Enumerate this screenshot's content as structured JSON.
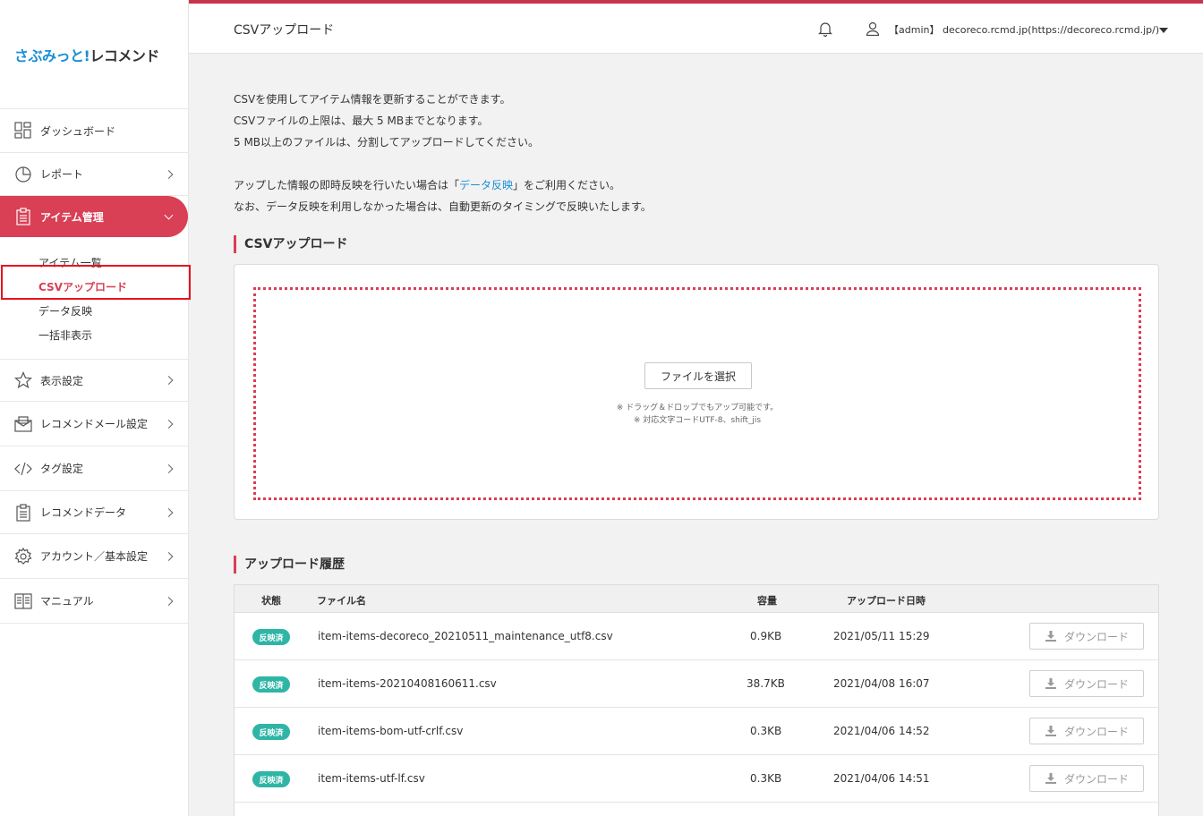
{
  "logo": {
    "part_a": "さぶみっと!",
    "part_b": "レコメンド"
  },
  "sidebar": {
    "items": [
      {
        "label": "ダッシュボード",
        "icon": "dashboard-icon"
      },
      {
        "label": "レポート",
        "icon": "pie-chart-icon"
      },
      {
        "label": "アイテム管理",
        "icon": "clipboard-icon"
      },
      {
        "label": "表示設定",
        "icon": "star-icon"
      },
      {
        "label": "レコメンドメール設定",
        "icon": "mail-icon"
      },
      {
        "label": "タグ設定",
        "icon": "code-icon"
      },
      {
        "label": "レコメンドデータ",
        "icon": "clipboard-icon"
      },
      {
        "label": "アカウント／基本設定",
        "icon": "gear-icon"
      },
      {
        "label": "マニュアル",
        "icon": "book-icon"
      }
    ],
    "sub_items": [
      "アイテム一覧",
      "CSVアップロード",
      "データ反映",
      "一括非表示"
    ]
  },
  "header": {
    "title": "CSVアップロード",
    "user": "【admin】 decoreco.rcmd.jp(https://decoreco.rcmd.jp/)"
  },
  "intro": {
    "line1": "CSVを使用してアイテム情報を更新することができます。",
    "line2": "CSVファイルの上限は、最大 5 MBまでとなります。",
    "line3": "5 MB以上のファイルは、分割してアップロードしてください。",
    "line4_prefix": "アップした情報の即時反映を行いたい場合は「",
    "line4_link": "データ反映",
    "line4_suffix": "」をご利用ください。",
    "line5": "なお、データ反映を利用しなかった場合は、自動更新のタイミングで反映いたします。"
  },
  "upload": {
    "section_title": "CSVアップロード",
    "button_label": "ファイルを選択",
    "note1": "※ ドラッグ＆ドロップでもアップ可能です。",
    "note2": "※ 対応文字コードUTF-8、shift_jis"
  },
  "history": {
    "section_title": "アップロード履歴",
    "columns": {
      "status": "状態",
      "filename": "ファイル名",
      "size": "容量",
      "date": "アップロード日時"
    },
    "download_label": "ダウンロード",
    "rows": [
      {
        "status": "反映済",
        "filename": "item-items-decoreco_20210511_maintenance_utf8.csv",
        "size": "0.9KB",
        "date": "2021/05/11 15:29"
      },
      {
        "status": "反映済",
        "filename": "item-items-20210408160611.csv",
        "size": "38.7KB",
        "date": "2021/04/08 16:07"
      },
      {
        "status": "反映済",
        "filename": "item-items-bom-utf-crlf.csv",
        "size": "0.3KB",
        "date": "2021/04/06 14:52"
      },
      {
        "status": "反映済",
        "filename": "item-items-utf-lf.csv",
        "size": "0.3KB",
        "date": "2021/04/06 14:51"
      }
    ]
  },
  "colors": {
    "accent": "#d93f55",
    "badge": "#2fb5a6",
    "link": "#1a8fd6"
  }
}
